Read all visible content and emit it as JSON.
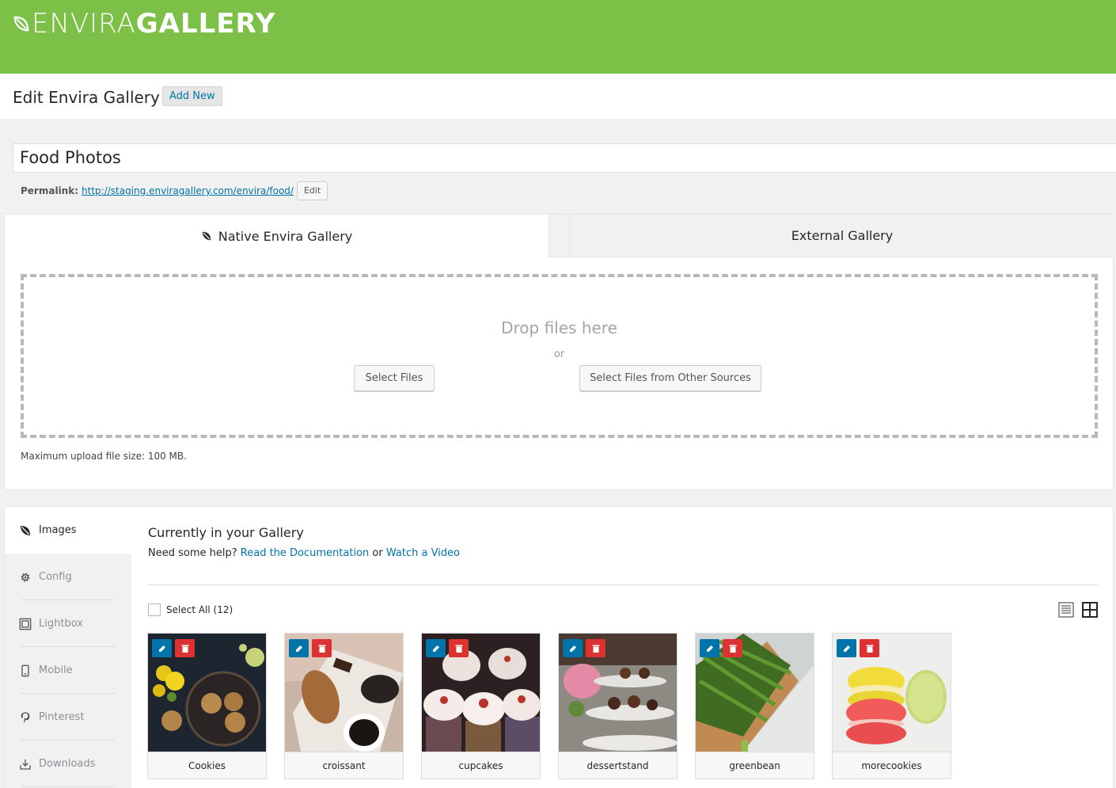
{
  "brand": {
    "logo_light": "ENVIRA",
    "logo_bold": "GALLERY",
    "color": "#7cc048"
  },
  "header": {
    "title": "Edit Envira Gallery",
    "add_new": "Add New"
  },
  "post": {
    "title_value": "Food Photos",
    "permalink_label": "Permalink:",
    "permalink_url": "http://staging.enviragallery.com/envira/food/",
    "edit_label": "Edit"
  },
  "tabs": [
    {
      "label": "Native Envira Gallery",
      "active": true,
      "icon": "envira-leaf-icon"
    },
    {
      "label": "External Gallery",
      "active": false
    }
  ],
  "upload": {
    "drop_text": "Drop files here",
    "or_text": "or",
    "select_files": "Select Files",
    "select_other": "Select Files from Other Sources",
    "max_size": "Maximum upload file size: 100 MB."
  },
  "sidebar": {
    "items": [
      {
        "label": "Images",
        "icon": "envira-leaf-icon",
        "active": true
      },
      {
        "label": "Config",
        "icon": "gear-icon"
      },
      {
        "label": "Lightbox",
        "icon": "lightbox-icon"
      },
      {
        "label": "Mobile",
        "icon": "mobile-icon"
      },
      {
        "label": "Pinterest",
        "icon": "pinterest-icon"
      },
      {
        "label": "Downloads",
        "icon": "download-icon"
      }
    ]
  },
  "gallery": {
    "heading": "Currently in your Gallery",
    "help_prefix": "Need some help?",
    "doc_link": "Read the Documentation",
    "help_or": "or",
    "video_link": "Watch a Video",
    "select_all": "Select All (12)",
    "images": [
      {
        "caption": "Cookies",
        "image": "dark-table-cookies-flowers"
      },
      {
        "caption": "croissant",
        "image": "croissant-coffee-chocolate"
      },
      {
        "caption": "cupcakes",
        "image": "frosted-cupcakes"
      },
      {
        "caption": "dessertstand",
        "image": "tiered-dessert-stand"
      },
      {
        "caption": "greenbean",
        "image": "green-beans-board"
      },
      {
        "caption": "morecookies",
        "image": "macarons"
      }
    ]
  }
}
